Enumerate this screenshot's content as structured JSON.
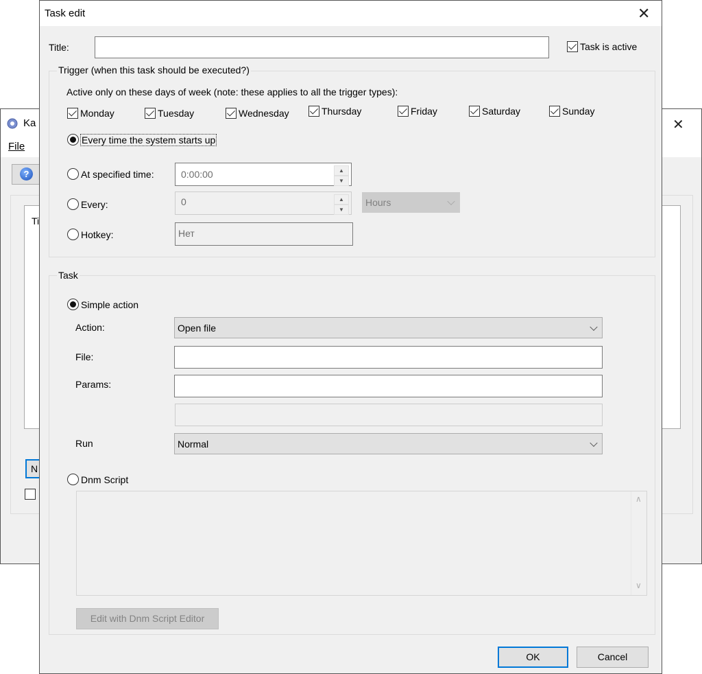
{
  "background_window": {
    "title": "Ka",
    "menu": [
      "File"
    ],
    "list_column_header": "Ti",
    "new_button_label": "N",
    "close_glyph": "✕",
    "help_glyph": "?"
  },
  "dialog": {
    "title": "Task edit",
    "close_glyph": "✕",
    "title_label": "Title:",
    "title_value": "",
    "task_is_active": {
      "label": "Task is active",
      "checked": true
    },
    "trigger": {
      "legend": "Trigger (when this task should be executed?)",
      "days_note": "Active only on these days of week (note: these applies to all the trigger types):",
      "days": [
        {
          "label": "Monday",
          "checked": true
        },
        {
          "label": "Tuesday",
          "checked": true
        },
        {
          "label": "Wednesday",
          "checked": true
        },
        {
          "label": "Thursday",
          "checked": true
        },
        {
          "label": "Friday",
          "checked": true
        },
        {
          "label": "Saturday",
          "checked": true
        },
        {
          "label": "Sunday",
          "checked": true
        }
      ],
      "options": {
        "startup": {
          "label": "Every time the system starts up",
          "selected": true
        },
        "at_time": {
          "label": "At specified time:",
          "selected": false,
          "value": "0:00:00"
        },
        "every": {
          "label": "Every:",
          "selected": false,
          "value": "0",
          "unit": "Hours"
        },
        "hotkey": {
          "label": "Hotkey:",
          "selected": false,
          "value": "Нет"
        }
      }
    },
    "task": {
      "legend": "Task",
      "simple_action": {
        "label": "Simple action",
        "selected": true
      },
      "action_label": "Action:",
      "action_value": "Open file",
      "file_label": "File:",
      "file_value": "",
      "params_label": "Params:",
      "params_value": "",
      "extra_value": "",
      "run_label": "Run",
      "run_value": "Normal",
      "dnm_script": {
        "label": "Dnm Script",
        "selected": false
      },
      "script_value": "",
      "edit_script_button": "Edit with Dnm Script Editor"
    },
    "buttons": {
      "ok": "OK",
      "cancel": "Cancel"
    }
  }
}
